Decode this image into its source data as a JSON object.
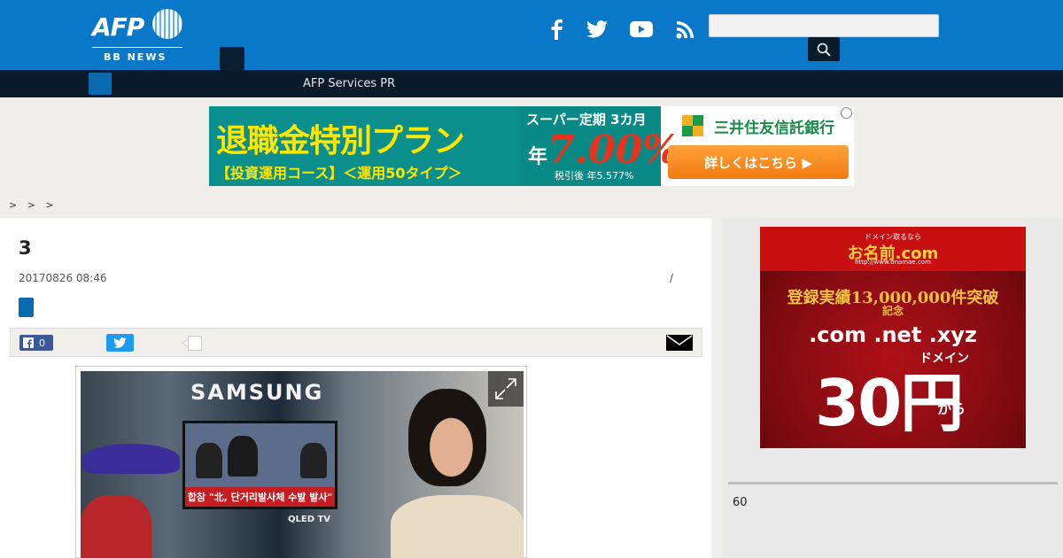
{
  "header": {
    "logo_text": "AFP",
    "logo_sub": "BB NEWS",
    "social": [
      "facebook-icon",
      "twitter-icon",
      "youtube-icon",
      "rss-icon"
    ],
    "search_value": "",
    "search_placeholder": ""
  },
  "nav": {
    "items": [
      {
        "label": "AFP Services PR"
      }
    ]
  },
  "banner_ad": {
    "title": "退職金特別プラン",
    "subtitle": "【投資運用コース】＜運用50タイプ＞",
    "super_label": "スーパー定期 3カ月",
    "rate_prefix": "年",
    "rate": "7.00%",
    "rate_note": "税引後 年5.577%",
    "bank": "三井住友信託銀行",
    "cta": "詳しくはこちら ▶"
  },
  "breadcrumb": "> > >",
  "article": {
    "title": "3",
    "date": "20170826 08:46",
    "meta_separator": "/",
    "share": {
      "facebook_count": "0"
    },
    "photo": {
      "sign_text": "SAMSUNG",
      "tv_caption": "합참 \"北, 단거리발사체 수발 발사\"",
      "tv_brand": "QLED TV"
    }
  },
  "sidebar": {
    "ad": {
      "small_text": "ドメイン取るなら",
      "brand": "お名前.com",
      "url": "http://www.onamae.com",
      "count_text": "登録実績13,000,000件突破",
      "kinen": "記念",
      "tlds": ".com .net .xyz",
      "domain_word": "ドメイン",
      "price": "30円",
      "kara": "から"
    },
    "number": "60"
  },
  "colors": {
    "header_blue": "#0a78c8",
    "navbar_dark": "#0a1c2c",
    "page_bg": "#f0eeea"
  }
}
